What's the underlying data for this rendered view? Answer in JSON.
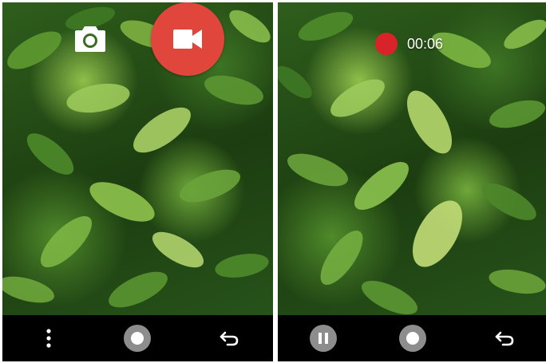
{
  "screens": [
    {
      "id": "video-ready",
      "top_controls": {
        "photo_mode_icon": "camera-icon",
        "record_icon": "videocam-icon",
        "record_color": "#e0463c"
      },
      "bottom_bar": {
        "menu_icon": "more-vert-icon",
        "shutter_icon": "shutter-icon",
        "back_icon": "undo-icon"
      }
    },
    {
      "id": "video-recording",
      "recording": {
        "elapsed_time": "00:06",
        "indicator_color": "#d9232b"
      },
      "bottom_bar": {
        "pause_icon": "pause-icon",
        "shutter_icon": "shutter-icon",
        "back_icon": "undo-icon"
      }
    }
  ]
}
